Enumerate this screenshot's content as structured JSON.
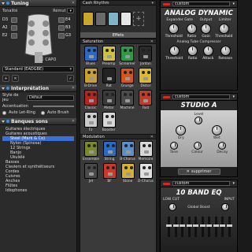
{
  "tuning": {
    "title": "Tuning",
    "tonalite_label": "Tonalité",
    "remut_label": "Rémut",
    "pegs": [
      "E4",
      "B3",
      "G3",
      "D3",
      "A2",
      "E2"
    ],
    "capo_label": "CAPO",
    "preset_value": "Standard (EADGBE)"
  },
  "interpretation": {
    "title": "Interprétation",
    "style_label": "Style de jeu",
    "style_value": "Défaut",
    "accentuation_label": "Accentuation",
    "auto_let_ring": "Auto Let-Ring",
    "auto_brush": "Auto Brush"
  },
  "banks": {
    "title": "Banques sons",
    "items": [
      {
        "label": "Guitares électriques",
        "level": 1,
        "selected": false
      },
      {
        "label": "Guitares acoustiques",
        "level": 1,
        "selected": false
      },
      {
        "label": "Steel (Mark & Co)",
        "level": 2,
        "selected": true
      },
      {
        "label": "Nylon (Spinosa)",
        "level": 2,
        "selected": false
      },
      {
        "label": "12 Strings",
        "level": 2,
        "selected": false
      },
      {
        "label": "Banjo",
        "level": 2,
        "selected": false
      },
      {
        "label": "Ukulélé",
        "level": 2,
        "selected": false
      },
      {
        "label": "Basses",
        "level": 1,
        "selected": false
      },
      {
        "label": "Claviers et synthétiseurs",
        "level": 1,
        "selected": false
      },
      {
        "label": "Cordes",
        "level": 1,
        "selected": false
      },
      {
        "label": "Cuivres",
        "level": 1,
        "selected": false
      },
      {
        "label": "Anches",
        "level": 1,
        "selected": false
      },
      {
        "label": "Flûtes",
        "level": 1,
        "selected": false
      },
      {
        "label": "Idiophones",
        "level": 1,
        "selected": false
      }
    ]
  },
  "effects": {
    "chain_title": "Cash Rhythm",
    "tabs": [
      "Effets"
    ],
    "chain_colors": [
      "#c9a72b",
      "#6a6a6a",
      "#7fb3c9",
      "#e6e6e6"
    ],
    "saturation": {
      "title": "Saturation",
      "pedals": [
        {
          "name": "Blues",
          "color": "#2c69c2"
        },
        {
          "name": "Preamp",
          "color": "#d2c23b"
        },
        {
          "name": "Screamer",
          "color": "#2d9a45"
        },
        {
          "name": "Jordan",
          "color": "#2a2a2a"
        },
        {
          "name": "B-Drive",
          "color": "#c9a227"
        },
        {
          "name": "Rat",
          "color": "#222222"
        },
        {
          "name": "Grunge",
          "color": "#d6551f"
        },
        {
          "name": "Distor",
          "color": "#e0b82b"
        },
        {
          "name": "Classic",
          "color": "#b3261e"
        },
        {
          "name": "Metal",
          "color": "#3a3a3a"
        },
        {
          "name": "Machine",
          "color": "#4a4a4a"
        },
        {
          "name": "Fast",
          "color": "#c23b28"
        },
        {
          "name": "Fz",
          "color": "#cccccc"
        },
        {
          "name": "Booster",
          "color": "#d8d8d8"
        }
      ]
    },
    "modulation": {
      "title": "Modulation",
      "pedals": [
        {
          "name": "Ensemble",
          "color": "#7a8a2a"
        },
        {
          "name": "String",
          "color": "#2a6ac2"
        },
        {
          "name": "B-Chorus",
          "color": "#5a8fc9"
        },
        {
          "name": "Memoire",
          "color": "#d8d8d8"
        },
        {
          "name": "Jet",
          "color": "#4a4a4a"
        },
        {
          "name": "BF",
          "color": "#c93a2a"
        },
        {
          "name": "Stone",
          "color": "#d7b02f"
        },
        {
          "name": "D-Chorus",
          "color": "#e0e0e0"
        }
      ]
    }
  },
  "rack": {
    "units": [
      {
        "preset": "custom",
        "title": "ANALOG DYNAMIC",
        "row1": [
          "Expander Gate",
          "Output",
          "Limiter"
        ],
        "row2": [
          "Threshold",
          "Ratio",
          "Gain",
          "Threshold"
        ],
        "row3_label": "Analog Tube Compressor",
        "row3": [
          "Threshold",
          "Ratio",
          "Attack",
          "Release"
        ]
      },
      {
        "preset": "custom",
        "title": "STUDIO A",
        "row1": [
          "Level"
        ],
        "row2": [
          "Dry",
          "Wet"
        ],
        "row3": [
          "Tone",
          "Colour",
          "Decay"
        ],
        "delete_label": "supprimer"
      },
      {
        "preset": "custom",
        "title": "10 BAND EQ",
        "input_label": "INPUT",
        "low_cut": "LOW CUT",
        "global_boost": "Global Boost"
      }
    ]
  }
}
